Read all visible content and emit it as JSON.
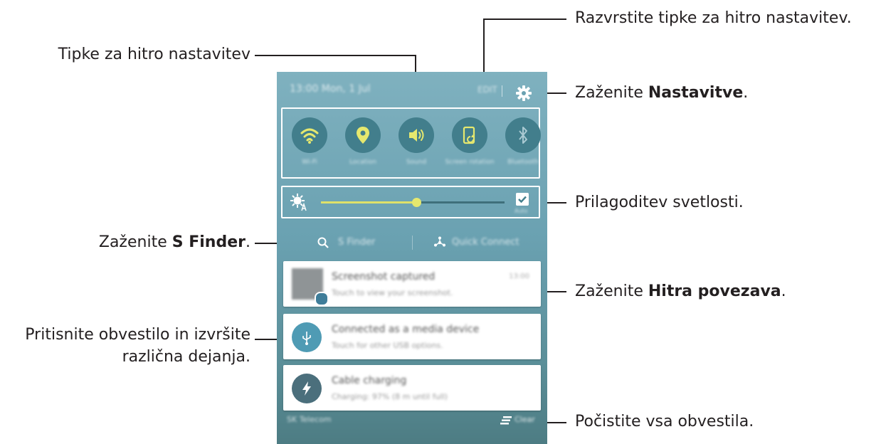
{
  "annotations": {
    "quick_buttons": "Tipke za hitro nastavitev",
    "rearrange": "Razvrstite tipke za hitro nastavitev.",
    "settings_prefix": "Zaženite ",
    "settings_bold": "Nastavitve",
    "settings_suffix": ".",
    "brightness": "Prilagoditev svetlosti.",
    "sfinder_prefix": "Zaženite ",
    "sfinder_bold": "S Finder",
    "sfinder_suffix": ".",
    "quickconnect_prefix": "Zaženite ",
    "quickconnect_bold": "Hitra povezava",
    "quickconnect_suffix": ".",
    "notification_line1": "Pritisnite obvestilo in izvršite",
    "notification_line2": "različna dejanja.",
    "clear_all": "Počistite vsa obvestila."
  },
  "panel": {
    "status_date": "13:00  Mon, 1 Jul",
    "edit_label": "EDIT",
    "quick_settings": [
      {
        "label": "Wi-Fi",
        "icon": "wifi-icon"
      },
      {
        "label": "Location",
        "icon": "location-icon"
      },
      {
        "label": "Sound",
        "icon": "sound-icon"
      },
      {
        "label": "Screen rotation",
        "icon": "screen-rotation-icon"
      },
      {
        "label": "Bluetooth",
        "icon": "bluetooth-icon"
      }
    ],
    "brightness": {
      "level": 0.52,
      "auto_label": "Auto",
      "auto_checked": true
    },
    "s_finder_label": "S Finder",
    "quick_connect_label": "Quick Connect",
    "notifications": [
      {
        "title": "Screenshot captured",
        "subtitle": "Touch to view your screenshot.",
        "time": "13:00"
      },
      {
        "title": "Connected as a media device",
        "subtitle": "Touch for other USB options."
      },
      {
        "title": "Cable charging",
        "subtitle": "Charging: 97% (8 m until full)"
      }
    ],
    "carrier": "SK Telecom",
    "clear_label": "Clear"
  },
  "colors": {
    "accent_yellow": "#e6e86e",
    "panel_teal": "#6aa1b1",
    "button_bg": "#427e8c"
  }
}
